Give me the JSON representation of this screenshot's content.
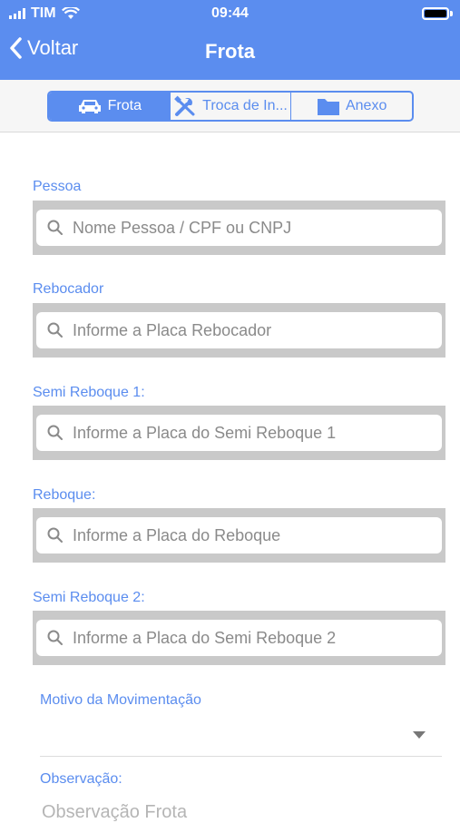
{
  "status_bar": {
    "carrier": "TIM",
    "time": "09:44"
  },
  "nav": {
    "back_label": "Voltar",
    "title": "Frota"
  },
  "segments": [
    {
      "label": "Frota",
      "icon": "car-icon",
      "active": true
    },
    {
      "label": "Troca de In...",
      "icon": "tools-icon",
      "active": false
    },
    {
      "label": "Anexo",
      "icon": "folder-icon",
      "active": false
    }
  ],
  "fields": [
    {
      "label": "Pessoa",
      "placeholder": "Nome Pessoa / CPF ou CNPJ",
      "value": ""
    },
    {
      "label": "Rebocador",
      "placeholder": "Informe a Placa Rebocador",
      "value": ""
    },
    {
      "label": "Semi Reboque 1:",
      "placeholder": "Informe a Placa do Semi Reboque 1",
      "value": ""
    },
    {
      "label": "Reboque:",
      "placeholder": "Informe a Placa do Reboque",
      "value": ""
    },
    {
      "label": "Semi Reboque 2:",
      "placeholder": "Informe a Placa do Semi Reboque 2",
      "value": ""
    }
  ],
  "motivo": {
    "label": "Motivo da Movimentação",
    "value": ""
  },
  "observacao": {
    "label": "Observação:",
    "placeholder": "Observação Frota"
  },
  "colors": {
    "accent": "#5b8def",
    "search_bar_bg": "#c9c9c9"
  }
}
